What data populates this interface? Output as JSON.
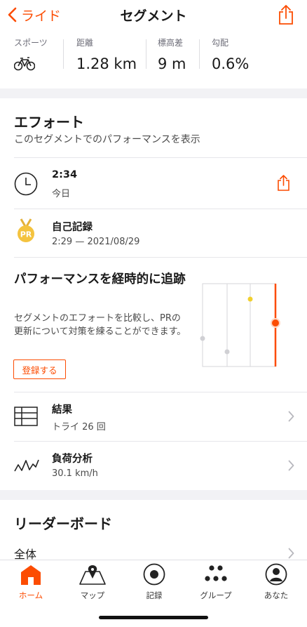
{
  "nav": {
    "back_label": "ライド",
    "title": "セグメント"
  },
  "stats": [
    {
      "label": "スポーツ",
      "value": ""
    },
    {
      "label": "距離",
      "value": "1.28 km"
    },
    {
      "label": "標高差",
      "value": "9 m"
    },
    {
      "label": "勾配",
      "value": "0.6%"
    }
  ],
  "effort": {
    "title": "エフォート",
    "subtitle": "このセグメントでのパフォーマンスを表示",
    "latest": {
      "time": "2:34",
      "when": "今日"
    },
    "pr": {
      "badge": "PR",
      "label": "自己記録",
      "detail": "2:29 — 2021/08/29"
    }
  },
  "promo": {
    "title": "パフォーマンスを経時的に追跡",
    "body": "セグメントのエフォートを比較し、PRの更新について対策を練ることができます。",
    "button": "登録する"
  },
  "results": {
    "label": "結果",
    "detail": "トライ 26 回"
  },
  "load": {
    "label": "負荷分析",
    "detail": "30.1 km/h"
  },
  "leaderboard": {
    "title": "リーダーボード",
    "first_item": "全体"
  },
  "tabs": [
    {
      "label": "ホーム",
      "icon": "home-icon",
      "active": true
    },
    {
      "label": "マップ",
      "icon": "map-icon",
      "active": false
    },
    {
      "label": "記録",
      "icon": "record-icon",
      "active": false
    },
    {
      "label": "グループ",
      "icon": "groups-icon",
      "active": false
    },
    {
      "label": "あなた",
      "icon": "profile-icon",
      "active": false
    }
  ],
  "colors": {
    "accent": "#fc4c02",
    "pr_gold": "#f4c33f",
    "chart_yellow": "#f1d02e"
  }
}
